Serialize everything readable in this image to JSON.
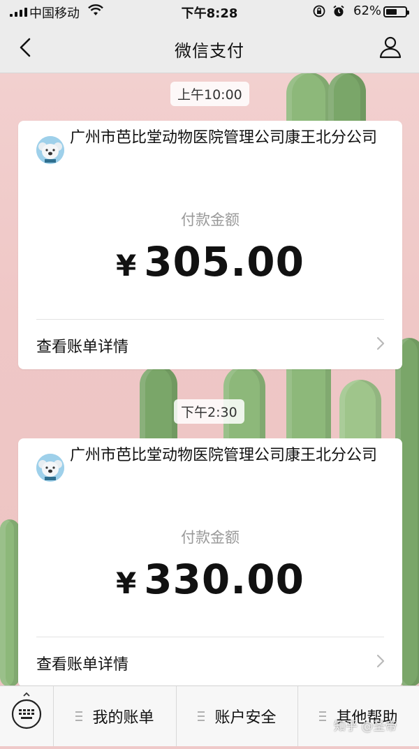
{
  "status_bar": {
    "carrier": "中国移动",
    "time": "下午8:28",
    "battery": "62%",
    "battery_level": 0.62
  },
  "nav": {
    "title": "微信支付"
  },
  "messages": [
    {
      "timestamp": "上午10:00",
      "merchant": "广州市芭比堂动物医院管理公司康王北分公司",
      "amount_label": "付款金额",
      "currency": "¥",
      "amount": "305.00",
      "detail_link": "查看账单详情"
    },
    {
      "timestamp": "下午2:30",
      "merchant": "广州市芭比堂动物医院管理公司康王北分公司",
      "amount_label": "付款金额",
      "currency": "¥",
      "amount": "330.00",
      "detail_link": "查看账单详情"
    }
  ],
  "bottom_menu": {
    "items": [
      "我的账单",
      "账户安全",
      "其他帮助"
    ]
  },
  "watermark": "知乎 @圣帝"
}
